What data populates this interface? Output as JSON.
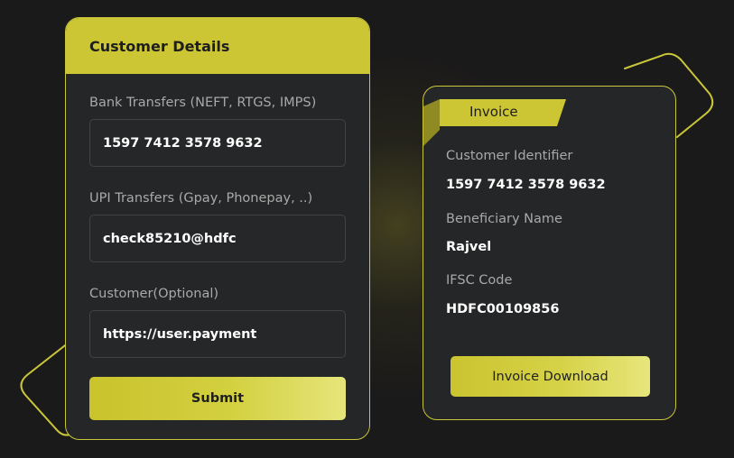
{
  "colors": {
    "background": "#1b1a1a",
    "accent": "#cdc634",
    "card": "#252627"
  },
  "customer_form": {
    "title": "Customer Details",
    "fields": [
      {
        "label": "Bank Transfers (NEFT, RTGS, IMPS)",
        "value": "1597 7412 3578 9632"
      },
      {
        "label": "UPI Transfers (Gpay, Phonepay, ..)",
        "value": "check85210@hdfc"
      },
      {
        "label": "Customer(Optional)",
        "value": "https://user.payment"
      }
    ],
    "submit_label": "Submit"
  },
  "invoice": {
    "title": "Invoice",
    "items": [
      {
        "label": "Customer Identifier",
        "value": "1597 7412 3578 9632"
      },
      {
        "label": "Beneficiary Name",
        "value": "Rajvel"
      },
      {
        "label": "IFSC Code",
        "value": "HDFC00109856"
      }
    ],
    "download_label": "Invoice Download"
  }
}
